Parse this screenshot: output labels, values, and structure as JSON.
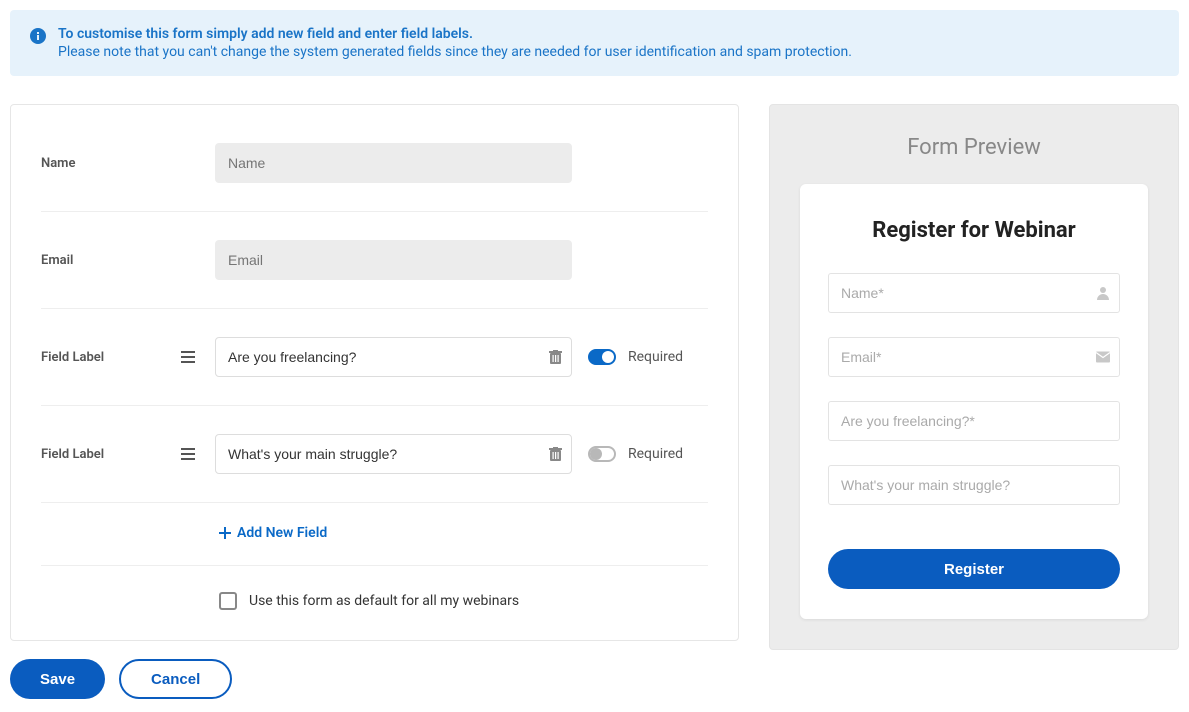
{
  "banner": {
    "line1": "To customise this form simply add new field and enter field labels.",
    "line2": "Please note that you can't change the system generated fields since they are needed for user identification and spam protection."
  },
  "editor": {
    "name_label": "Name",
    "name_placeholder": "Name",
    "email_label": "Email",
    "email_placeholder": "Email",
    "field_label_text": "Field Label",
    "required_text": "Required",
    "custom_fields": [
      {
        "value": "Are you freelancing?",
        "required": true
      },
      {
        "value": "What's your main struggle?",
        "required": false
      }
    ],
    "add_new_text": "Add New Field",
    "default_checkbox_label": "Use this form as default for all my webinars"
  },
  "preview": {
    "panel_title": "Form Preview",
    "card_title": "Register for Webinar",
    "fields": [
      {
        "placeholder": "Name*",
        "icon": "user"
      },
      {
        "placeholder": "Email*",
        "icon": "mail"
      },
      {
        "placeholder": "Are you freelancing?*",
        "icon": null
      },
      {
        "placeholder": "What's your main struggle?",
        "icon": null
      }
    ],
    "submit_label": "Register"
  },
  "actions": {
    "save": "Save",
    "cancel": "Cancel"
  },
  "colors": {
    "blue_primary": "#0a5cbf",
    "blue_link": "#0a69c7",
    "banner_bg": "#e6f2fb",
    "muted": "#888888"
  }
}
